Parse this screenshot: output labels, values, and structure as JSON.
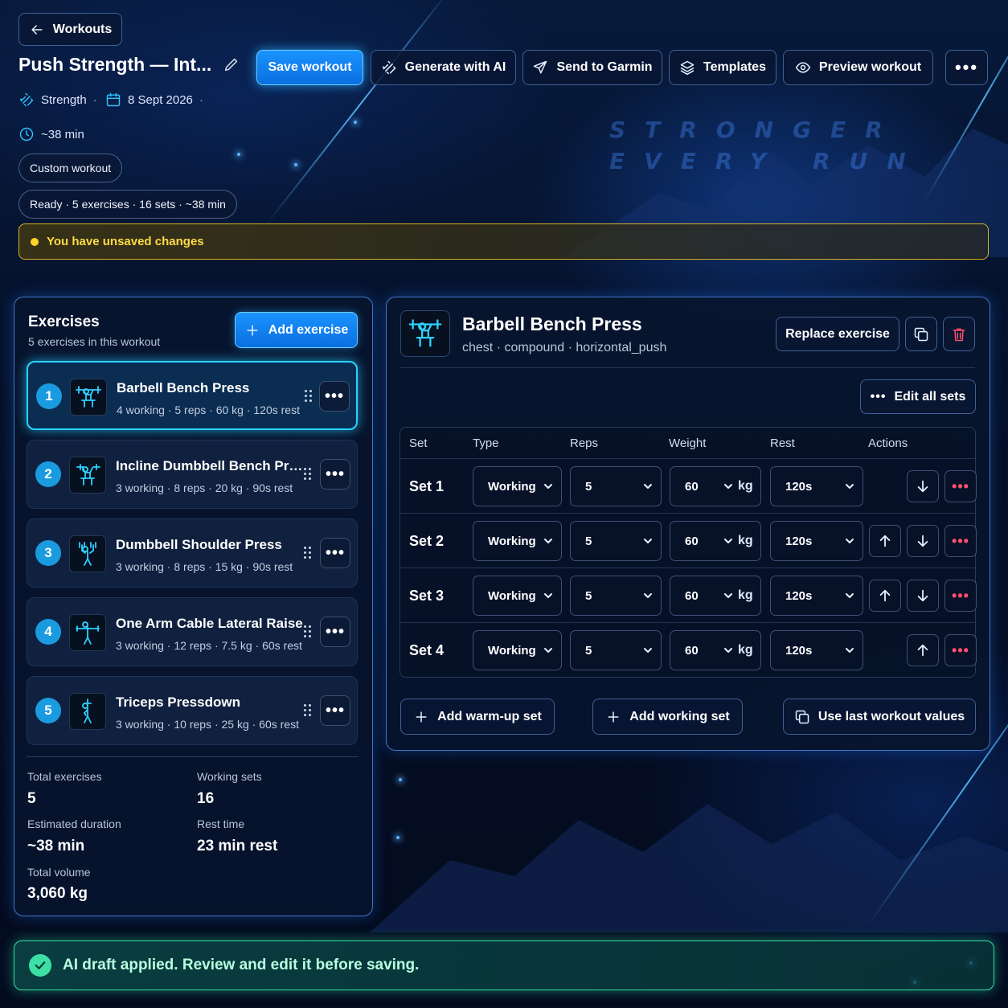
{
  "header": {
    "back_label": "Workouts",
    "workout_title": "Push Strength — Int...",
    "meta": {
      "type": "Strength",
      "date": "8 Sept 2026",
      "duration": "~38 min"
    },
    "tag": "Custom workout",
    "status": "Ready · 5 exercises · 16 sets · ~38 min",
    "actions": {
      "save": "Save workout",
      "generate": "Generate with AI",
      "send": "Send to Garmin",
      "templates": "Templates",
      "preview": "Preview workout"
    }
  },
  "slogan": {
    "line1": "STRONGER",
    "line2": "EVERY RUN"
  },
  "unsaved_banner": "You have unsaved changes",
  "exercises_panel": {
    "title": "Exercises",
    "subtitle": "5 exercises in this workout",
    "add_label": "Add exercise",
    "items": [
      {
        "index": "1",
        "name": "Barbell Bench Press",
        "detail": "4 working · 5 reps · 60 kg · 120s rest",
        "icon": "bench-press-icon"
      },
      {
        "index": "2",
        "name": "Incline Dumbbell Bench Press",
        "detail": "3 working · 8 reps · 20 kg · 90s rest",
        "icon": "incline-press-icon"
      },
      {
        "index": "3",
        "name": "Dumbbell Shoulder Press",
        "detail": "3 working · 8 reps · 15 kg · 90s rest",
        "icon": "shoulder-press-icon"
      },
      {
        "index": "4",
        "name": "One Arm Cable Lateral Raise",
        "detail": "3 working · 12 reps · 7.5 kg · 60s rest",
        "icon": "lateral-raise-icon"
      },
      {
        "index": "5",
        "name": "Triceps Pressdown",
        "detail": "3 working · 10 reps · 25 kg · 60s rest",
        "icon": "pressdown-icon"
      }
    ],
    "stats": {
      "total_exercises_label": "Total exercises",
      "total_exercises": "5",
      "working_sets_label": "Working sets",
      "working_sets": "16",
      "duration_label": "Estimated duration",
      "duration": "~38 min",
      "rest_label": "Rest time",
      "rest": "23 min rest",
      "volume_label": "Total volume",
      "volume": "3,060 kg"
    }
  },
  "detail": {
    "name": "Barbell Bench Press",
    "tags": "chest · compound · horizontal_push",
    "replace_label": "Replace exercise",
    "edit_all_label": "Edit all sets",
    "columns": [
      "Set",
      "Type",
      "Reps",
      "Weight",
      "Rest",
      "Actions"
    ],
    "unit": "kg",
    "sets": [
      {
        "label": "Set 1",
        "type": "Working",
        "reps": "5",
        "weight": "60",
        "rest": "120s"
      },
      {
        "label": "Set 2",
        "type": "Working",
        "reps": "5",
        "weight": "60",
        "rest": "120s"
      },
      {
        "label": "Set 3",
        "type": "Working",
        "reps": "5",
        "weight": "60",
        "rest": "120s"
      },
      {
        "label": "Set 4",
        "type": "Working",
        "reps": "5",
        "weight": "60",
        "rest": "120s"
      }
    ],
    "add_warmup_label": "Add warm-up set",
    "add_working_label": "Add working set",
    "use_last_label": "Use last workout values"
  },
  "ai_banner": "AI draft applied. Review and edit it before saving.",
  "colors": {
    "accent": "#1a93ff",
    "cyan": "#2ad4ff",
    "warning": "#ffdc45",
    "success": "#2fe0a0",
    "danger": "#ff4f6e"
  }
}
